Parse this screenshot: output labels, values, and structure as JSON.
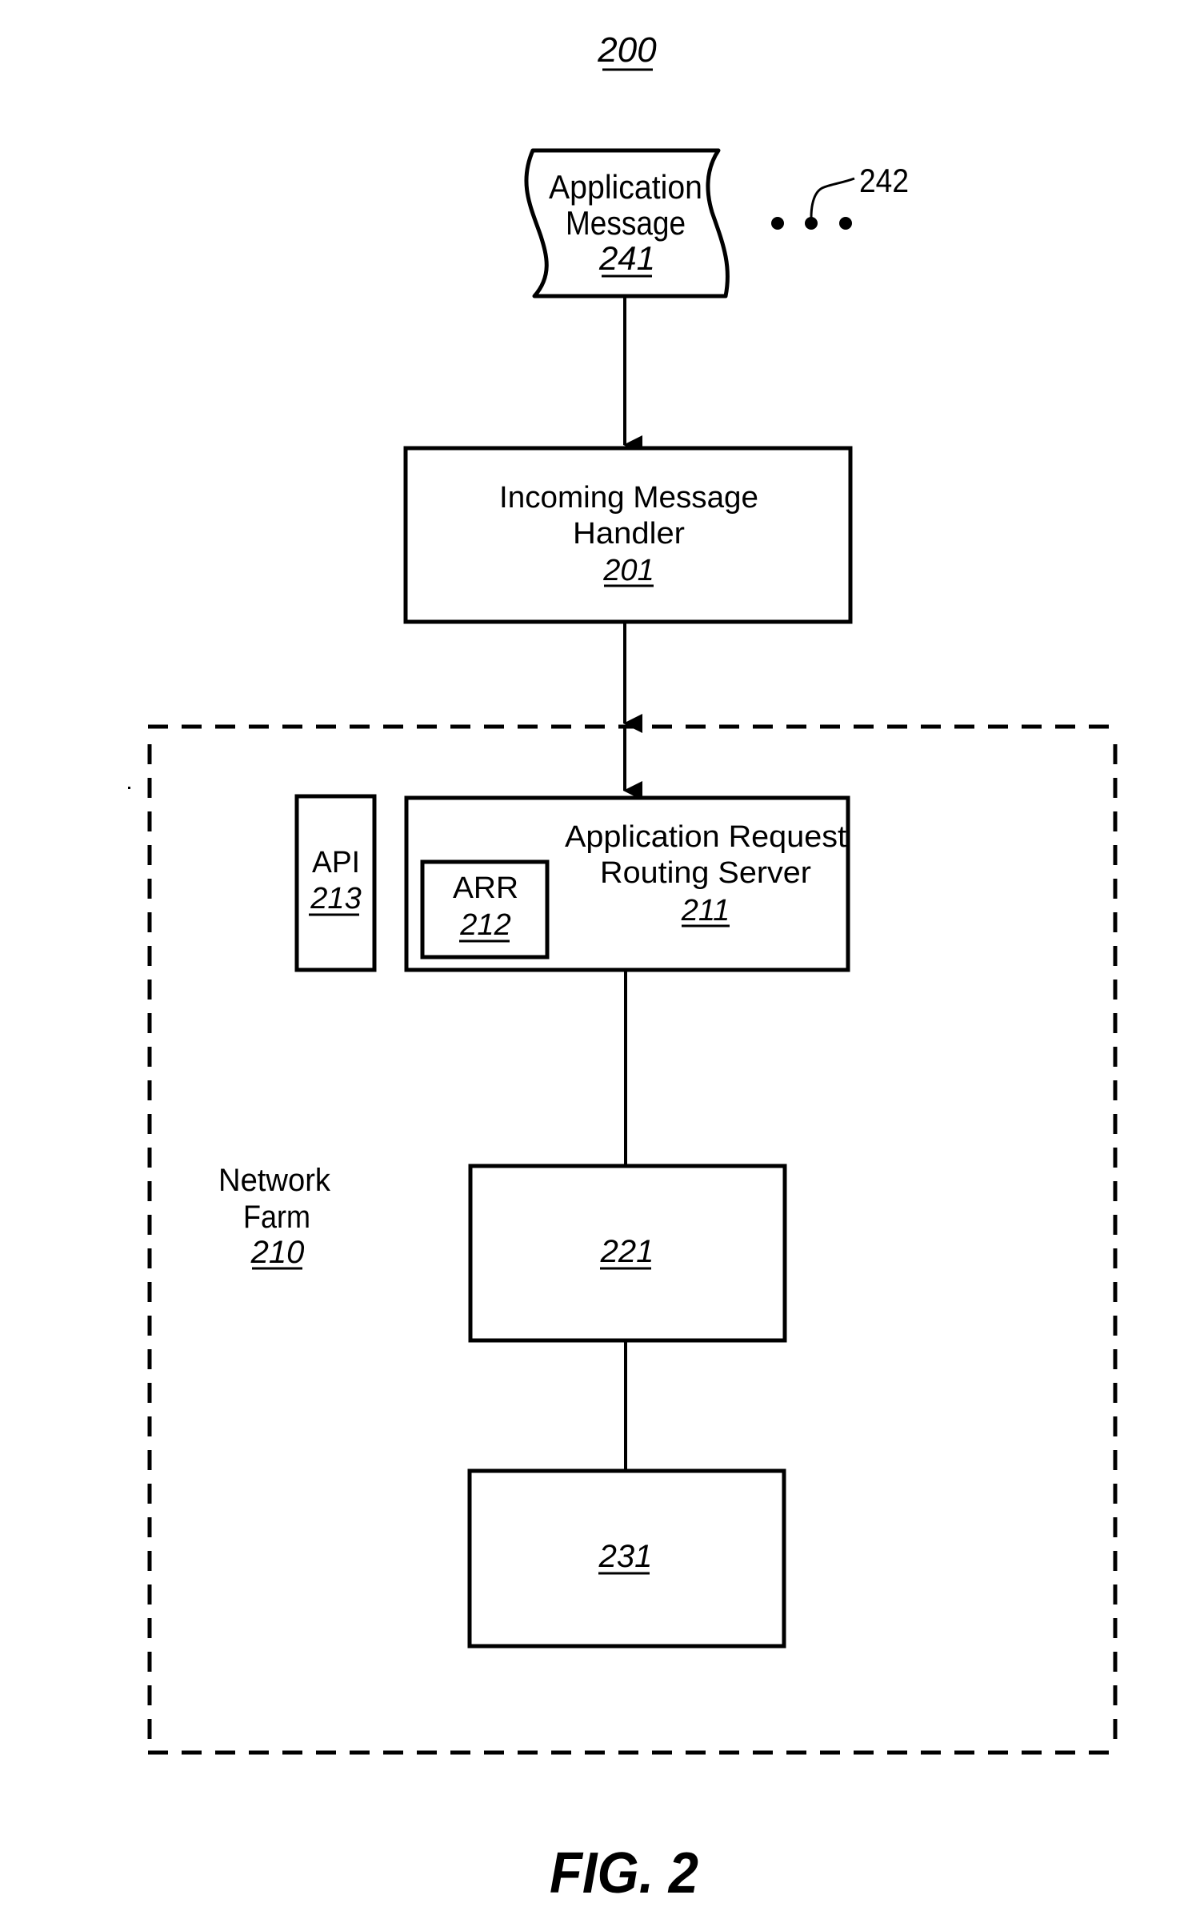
{
  "figure": {
    "number_ref": "200",
    "caption": "FIG. 2"
  },
  "application_message": {
    "line1": "Application",
    "line2": "Message",
    "ref": "241",
    "more_ref": "242"
  },
  "incoming_message_handler": {
    "line1": "Incoming Message",
    "line2": "Handler",
    "ref": "201"
  },
  "network_farm": {
    "line1": "Network",
    "line2": "Farm",
    "ref": "210"
  },
  "api": {
    "label": "API",
    "ref": "213"
  },
  "arr_server": {
    "line1": "Application Request",
    "line2": "Routing Server",
    "ref": "211"
  },
  "arr": {
    "label": "ARR",
    "ref": "212"
  },
  "server_221": {
    "ref": "221"
  },
  "server_231": {
    "ref": "231"
  }
}
